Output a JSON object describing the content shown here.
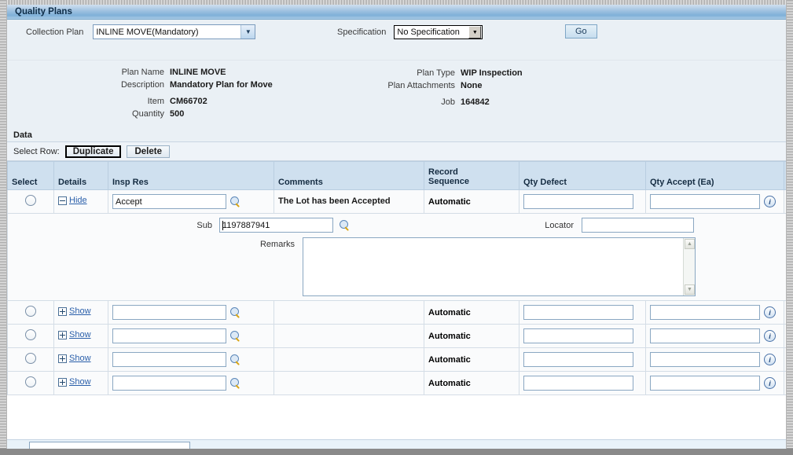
{
  "window": {
    "title": "Quality Plans"
  },
  "query": {
    "collection_plan_label": "Collection Plan",
    "collection_plan_value": "INLINE MOVE(Mandatory)",
    "specification_label": "Specification",
    "specification_value": "No Specification",
    "go_label": "Go"
  },
  "plan_info": {
    "left": [
      {
        "label": "Plan Name",
        "value": "INLINE MOVE"
      },
      {
        "label": "Description",
        "value": "Mandatory Plan for Move"
      },
      {
        "label": "Item",
        "value": "CM66702"
      },
      {
        "label": "Quantity",
        "value": "500"
      }
    ],
    "right": [
      {
        "label": "Plan Type",
        "value": "WIP Inspection"
      },
      {
        "label": "Plan Attachments",
        "value": "None"
      },
      {
        "label": "Job",
        "value": "164842"
      }
    ]
  },
  "data_section": {
    "heading": "Data",
    "select_row_label": "Select Row:",
    "duplicate_label": "Duplicate",
    "delete_label": "Delete",
    "columns": [
      "Select",
      "Details",
      "Insp Res",
      "Comments",
      "Record Sequence",
      "Qty Defect",
      "Qty Accept (Ea)",
      ""
    ],
    "rows": [
      {
        "details_link": "Hide",
        "details_expanded": true,
        "insp_res": "Accept",
        "comments": "The Lot has been Accepted",
        "record_sequence": "Automatic",
        "qty_defect": "",
        "qty_accept": ""
      },
      {
        "details_link": "Show",
        "details_expanded": false,
        "insp_res": "",
        "comments": "",
        "record_sequence": "Automatic",
        "qty_defect": "",
        "qty_accept": ""
      },
      {
        "details_link": "Show",
        "details_expanded": false,
        "insp_res": "",
        "comments": "",
        "record_sequence": "Automatic",
        "qty_defect": "",
        "qty_accept": ""
      },
      {
        "details_link": "Show",
        "details_expanded": false,
        "insp_res": "",
        "comments": "",
        "record_sequence": "Automatic",
        "qty_defect": "",
        "qty_accept": ""
      },
      {
        "details_link": "Show",
        "details_expanded": false,
        "insp_res": "",
        "comments": "",
        "record_sequence": "Automatic",
        "qty_defect": "",
        "qty_accept": ""
      }
    ],
    "detail_panel": {
      "sub_label": "Sub",
      "sub_value": "1197887941",
      "locator_label": "Locator",
      "locator_value": "",
      "remarks_label": "Remarks",
      "remarks_value": ""
    }
  },
  "icons": {
    "lov_search": "magnifier-icon",
    "info": "i",
    "add_row": "plus-icon",
    "scroll_up": "▲",
    "scroll_down": "▼",
    "caret_down": "▼"
  },
  "colors": {
    "header_blue": "#7fb0d8",
    "region_bg": "#eaf0f5",
    "grid_header": "#cfe0ef",
    "link": "#2a5faa",
    "add_green": "#3faa35"
  }
}
